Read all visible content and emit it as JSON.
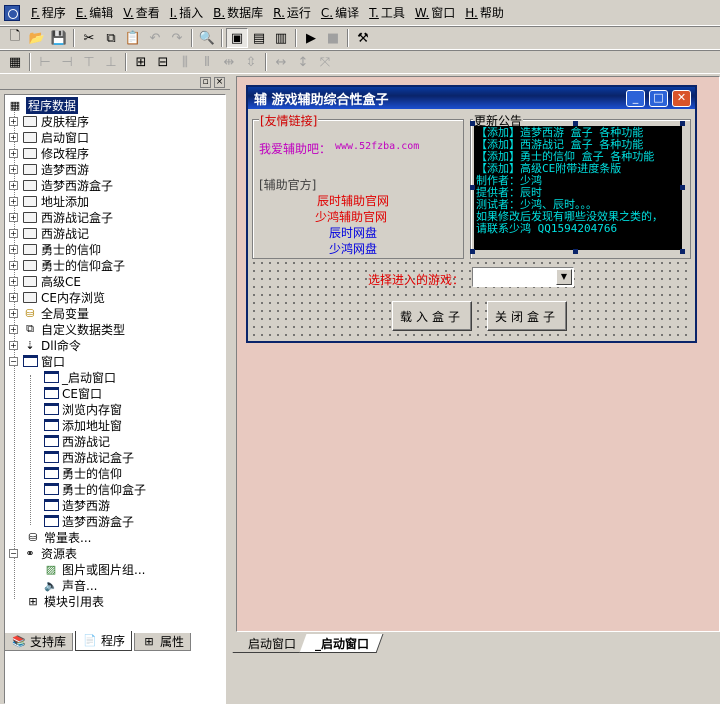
{
  "menu": [
    {
      "hk": "F.",
      "label": "程序"
    },
    {
      "hk": "E.",
      "label": "编辑"
    },
    {
      "hk": "V.",
      "label": "查看"
    },
    {
      "hk": "I.",
      "label": "插入"
    },
    {
      "hk": "B.",
      "label": "数据库"
    },
    {
      "hk": "R.",
      "label": "运行"
    },
    {
      "hk": "C.",
      "label": "编译"
    },
    {
      "hk": "T.",
      "label": "工具"
    },
    {
      "hk": "W.",
      "label": "窗口"
    },
    {
      "hk": "H.",
      "label": "帮助"
    }
  ],
  "tree": {
    "root": "程序数据",
    "items": [
      {
        "label": "皮肤程序"
      },
      {
        "label": "启动窗口"
      },
      {
        "label": "修改程序"
      },
      {
        "label": "造梦西游"
      },
      {
        "label": "造梦西游盒子"
      },
      {
        "label": "地址添加"
      },
      {
        "label": "西游战记盒子"
      },
      {
        "label": "西游战记"
      },
      {
        "label": "勇士的信仰"
      },
      {
        "label": "勇士的信仰盒子"
      },
      {
        "label": "高级CE"
      },
      {
        "label": "CE内存浏览"
      },
      {
        "label": "全局变量"
      },
      {
        "label": "自定义数据类型"
      },
      {
        "label": "Dll命令"
      },
      {
        "label": "窗口"
      }
    ],
    "windows": [
      "_启动窗口",
      "CE窗口",
      "浏览内存窗",
      "添加地址窗",
      "西游战记",
      "西游战记盒子",
      "勇士的信仰",
      "勇士的信仰盒子",
      "造梦西游",
      "造梦西游盒子"
    ],
    "tail": [
      {
        "label": "常量表..."
      },
      {
        "label": "资源表"
      },
      {
        "label": "图片或图片组..."
      },
      {
        "label": "声音..."
      },
      {
        "label": "模块引用表"
      }
    ]
  },
  "left_tabs": [
    "支持库",
    "程序",
    "属性"
  ],
  "form": {
    "title": "辅 游戏辅助综合性盒子",
    "links_title": "[友情链接]",
    "link_label": "我爱辅助吧：",
    "link_url": "www.52fzba.com",
    "official_title": "[辅助官方]",
    "official_links": [
      "辰时辅助官网",
      "少鸿辅助官网",
      "辰时网盘",
      "少鸿网盘"
    ],
    "news_title": "更新公告",
    "news_lines": [
      "【添加】造梦西游  盒子 各种功能",
      "【添加】西游战记  盒子 各种功能",
      "【添加】勇士的信仰  盒子 各种功能",
      "【添加】高级CE附带进度条版",
      "制作者：少鸿",
      "提供者：辰时",
      "测试者：少鸿、辰时。。。",
      "如果修改后发现有哪些没效果之类的，",
      "请联系少鸿  QQ1594204766"
    ],
    "select_label": "选择进入的游戏：",
    "load_button": "载入盒子",
    "close_button": "关闭盒子"
  },
  "right_tabs": [
    "启动窗口",
    "_启动窗口"
  ]
}
